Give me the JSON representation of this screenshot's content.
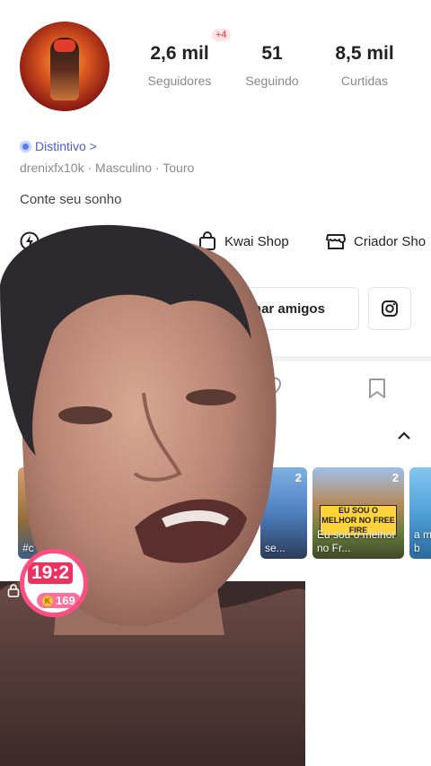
{
  "profile": {
    "followers": {
      "value": "2,6 mil",
      "label": "Seguidores",
      "badge": "+4"
    },
    "following": {
      "value": "51",
      "label": "Seguindo"
    },
    "likes": {
      "value": "8,5 mil",
      "label": "Curtidas"
    },
    "badge_link": "Distintivo >",
    "meta": "drenixfx10k  ·  Masculino  ·  Touro",
    "bio": "Conte seu sonho"
  },
  "links": {
    "kwai_shop": "Kwai Shop",
    "creator": "Criador Sho"
  },
  "buttons": {
    "add_friends": "icionar amigos"
  },
  "thumbnails": [
    {
      "count": "2",
      "caption": "se..."
    },
    {
      "count": "2",
      "tag": "EU SOU O MELHOR NO FREE FIRE",
      "caption": "Eu sou o melhor no Fr..."
    },
    {
      "count": "",
      "caption": "a m é b"
    }
  ],
  "left_thumb_caption": "#c",
  "timer": {
    "time": "19:2",
    "coins": "169",
    "coin_symbol": "K"
  },
  "colors": {
    "accent": "#f0313f",
    "link_blue": "#4a5cc8",
    "timer_pink": "#ff4e84"
  }
}
